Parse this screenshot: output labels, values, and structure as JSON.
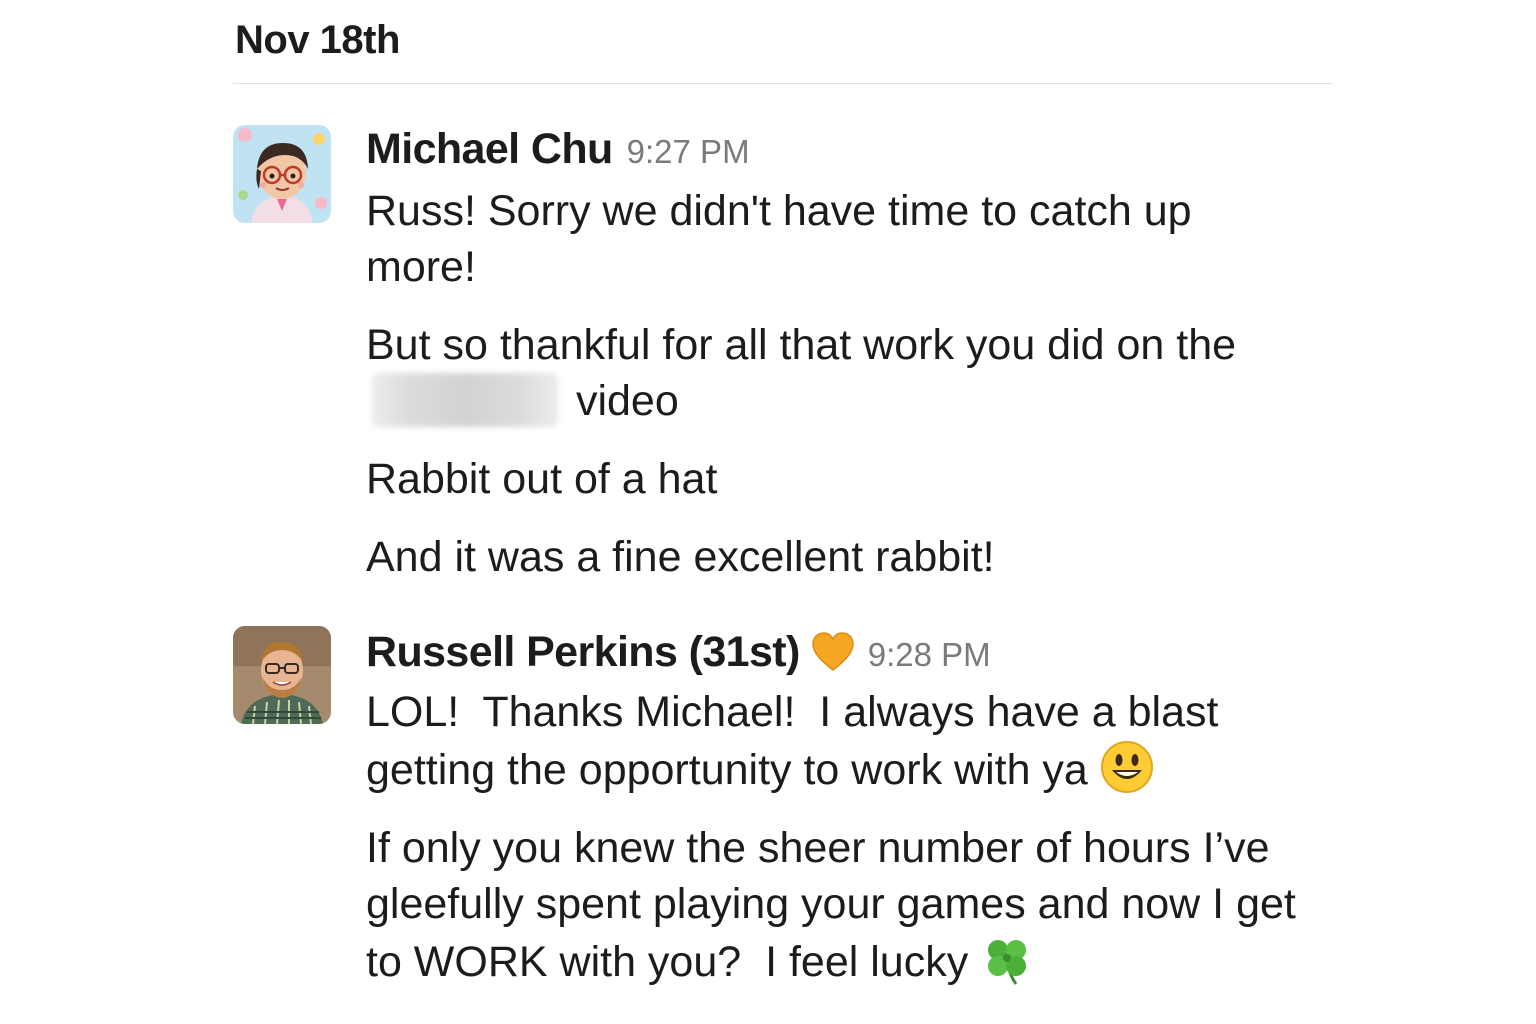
{
  "day_divider": {
    "label": "Nov 18th"
  },
  "messages": [
    {
      "author": "Michael Chu",
      "time": "9:27 PM",
      "avatar_icon": "cartoon-avatar-michael",
      "paragraphs": [
        "Russ! Sorry we didn't have time to catch up more!",
        {
          "before": "But so thankful for all that work you did on the ",
          "redacted": "",
          "after": " video"
        },
        "Rabbit out of a hat",
        "And it was a fine excellent rabbit!"
      ]
    },
    {
      "author": "Russell Perkins (31st)",
      "status_emoji": "orange-heart-icon",
      "time": "9:28 PM",
      "avatar_icon": "photo-avatar-russell",
      "paragraphs": [
        {
          "text": "LOL!  Thanks Michael!  I always have a blast getting the opportunity to work with ya ",
          "emoji": "smiley-face-icon"
        },
        {
          "text": "If only you knew the sheer number of hours I’ve gleefully spent playing your games and now I get to WORK with you?  I feel lucky ",
          "emoji": "four-leaf-clover-icon"
        }
      ]
    }
  ],
  "colors": {
    "text": "#1d1c1d",
    "timestamp": "#7a7a7a",
    "divider": "#e2e2e2",
    "status_heart": "#f5a623"
  }
}
